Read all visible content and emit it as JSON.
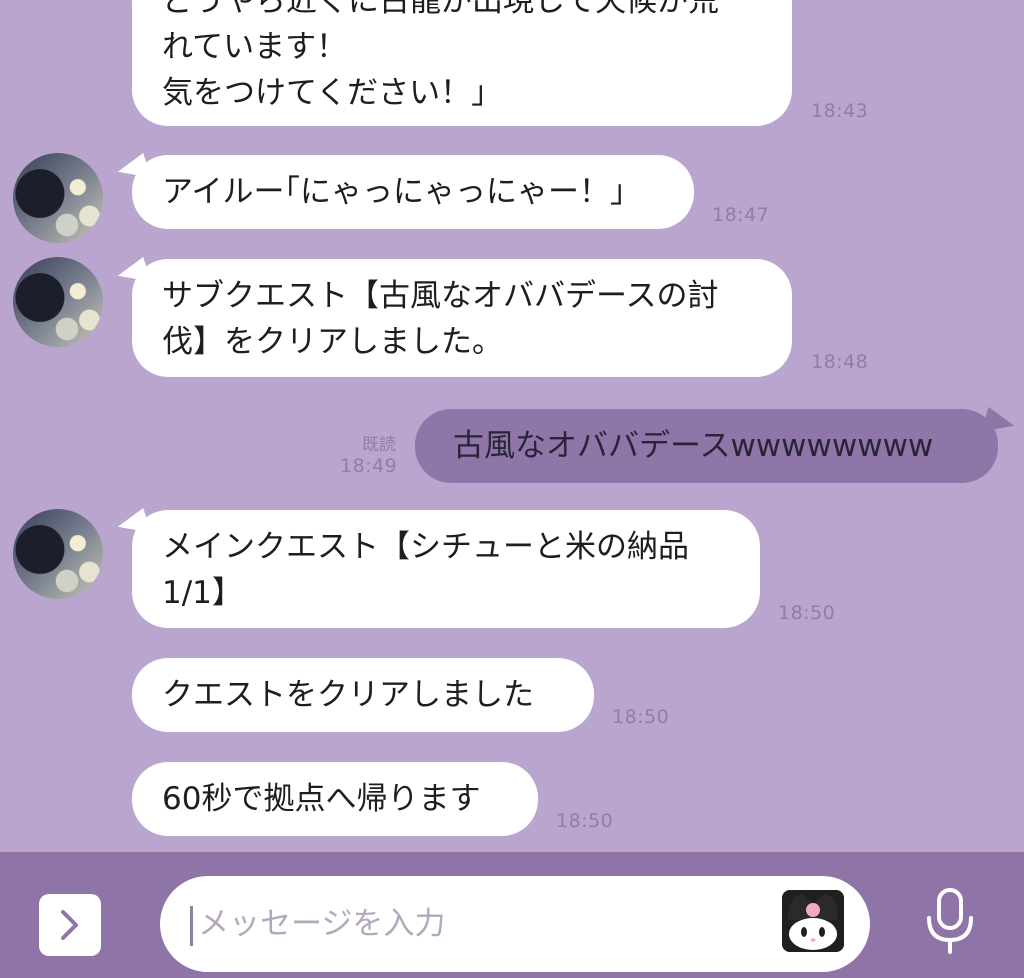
{
  "messages": [
    {
      "text_line1": "どうやら近くに古龍が出現して天候が荒",
      "text_line2": "れています！",
      "text_line3": "気をつけてください！」",
      "time": "18:43"
    },
    {
      "text": "アイルー｢にゃっにゃっにゃー！」",
      "time": "18:47"
    },
    {
      "text_line1": "サブクエスト【古風なオババデースの討",
      "text_line2": "伐】をクリアしました。",
      "time": "18:48"
    },
    {
      "text": "古風なオババデースwwwwwwww",
      "time": "18:49",
      "read": "既読"
    },
    {
      "text_line1": "メインクエスト【シチューと米の納品",
      "text_line2": "1/1】",
      "time": "18:50"
    },
    {
      "text": "クエストをクリアしました",
      "time": "18:50"
    },
    {
      "text": "60秒で拠点へ帰ります",
      "time": "18:50"
    }
  ],
  "input": {
    "placeholder": "メッセージを入力"
  },
  "icons": {
    "expand": "chevron-right-icon",
    "sticker": "sticker-icon",
    "mic": "microphone-icon"
  },
  "colors": {
    "background": "#b9a5cd",
    "bar": "#8f75a7",
    "my_bubble": "#8e77a8",
    "bubble": "#ffffff"
  }
}
